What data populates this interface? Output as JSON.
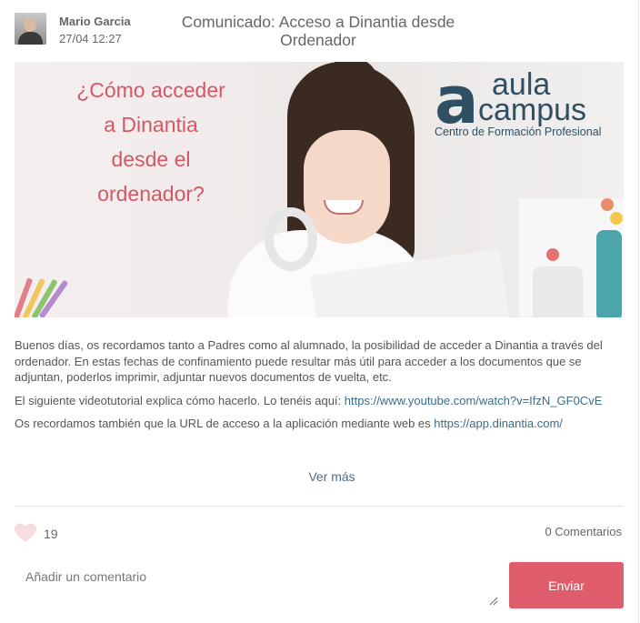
{
  "post": {
    "author": "Mario Garcia",
    "date": "27/04 12:27",
    "title": "Comunicado: Acceso a Dinantia desde Ordenador"
  },
  "banner": {
    "headline_lines": [
      "¿Cómo acceder",
      "a Dinantia",
      "desde el",
      "ordenador?"
    ],
    "logo_letter": "a",
    "logo_word_top": "aula",
    "logo_word_bottom": "campus",
    "logo_subtitle": "Centro de Formación Profesional",
    "colors": {
      "headline": "#d55766",
      "logo": "#2f4f63"
    }
  },
  "body": {
    "paragraph1": "Buenos días, os recordamos tanto a Padres como al alumnado, la posibilidad de acceder a Dinantia a través del ordenador. En estas fechas de confinamiento puede resultar más útil para acceder a los documentos que se adjuntan, poderlos imprimir, adjuntar nuevos documentos de vuelta, etc.",
    "paragraph2_text": "El siguiente videotutorial explica cómo hacerlo. Lo tenéis aquí: ",
    "paragraph2_link": "https://www.youtube.com/watch?v=IfzN_GF0CvE",
    "paragraph3_text": "Os recordamos también que la URL de acceso a la aplicación mediante web es ",
    "paragraph3_link": "https://app.dinantia.com/",
    "see_more": "Ver más"
  },
  "footer": {
    "likes": "19",
    "comments": "0 Comentarios",
    "comment_placeholder": "Añadir un comentario",
    "send_label": "Enviar",
    "icons": {
      "like": "heart-icon"
    },
    "colors": {
      "send_button": "#df5c6c",
      "heart": "#f7dede"
    }
  }
}
